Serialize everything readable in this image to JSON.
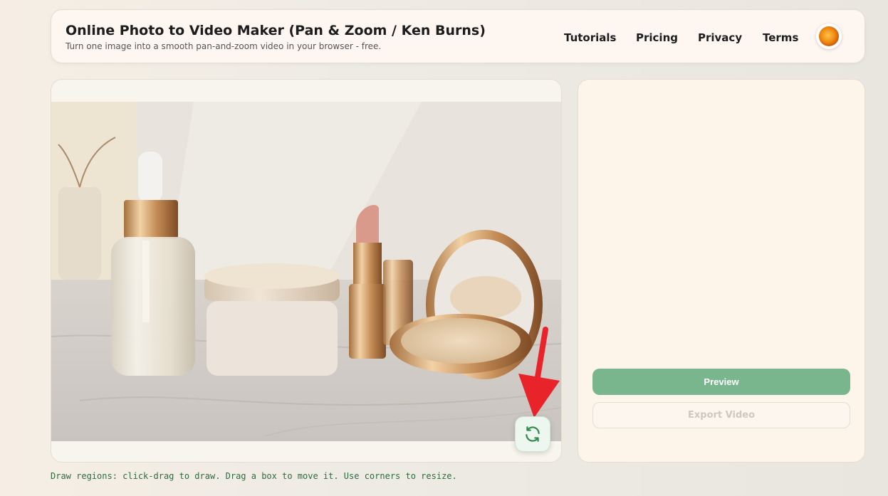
{
  "header": {
    "title": "Online Photo to Video Maker (Pan & Zoom / Ken Burns)",
    "subtitle": "Turn one image into a smooth pan-and-zoom video in your browser - free.",
    "nav": [
      {
        "label": "Tutorials"
      },
      {
        "label": "Pricing"
      },
      {
        "label": "Privacy"
      },
      {
        "label": "Terms"
      }
    ]
  },
  "canvas": {
    "image_description_icon": "photo-cosmetics",
    "refresh_icon": "refresh-icon"
  },
  "controls": {
    "preview_label": "Preview",
    "export_label": "Export Video"
  },
  "hint": "Draw regions: click-drag to draw. Drag a box to move it. Use corners to resize.",
  "colors": {
    "accent_green": "#79b58d",
    "annotation_arrow": "#e8232a"
  }
}
